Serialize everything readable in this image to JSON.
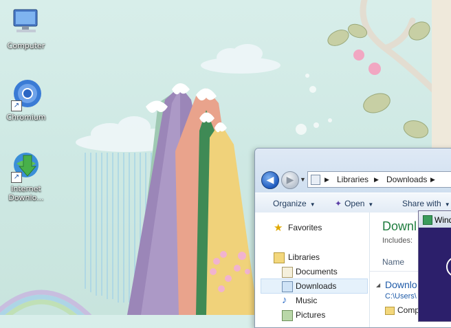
{
  "desktop": {
    "icons": [
      {
        "label": "Computer",
        "name": "computer"
      },
      {
        "label": "Chromium",
        "name": "chromium"
      },
      {
        "label_line1": "Internet",
        "label_line2": "Downlo...",
        "name": "internet-download-manager"
      }
    ]
  },
  "explorer": {
    "breadcrumb": [
      "Libraries",
      "Downloads"
    ],
    "toolbar": {
      "organize": "Organize",
      "open": "Open",
      "share_with": "Share with"
    },
    "nav": {
      "favorites": "Favorites",
      "libraries": "Libraries",
      "documents": "Documents",
      "downloads": "Downloads",
      "music": "Music",
      "pictures": "Pictures"
    },
    "content": {
      "title": "Downl",
      "includes": "Includes:",
      "column_name": "Name",
      "group_title": "Downlo",
      "group_path": "C:\\Users\\",
      "first_item": "Comp"
    }
  },
  "overlay_window": {
    "title": "Wind"
  },
  "colors": {
    "accent_green": "#1e7c3e",
    "link_blue": "#1e5aa8",
    "overlay_bg": "#2c1f6b"
  }
}
